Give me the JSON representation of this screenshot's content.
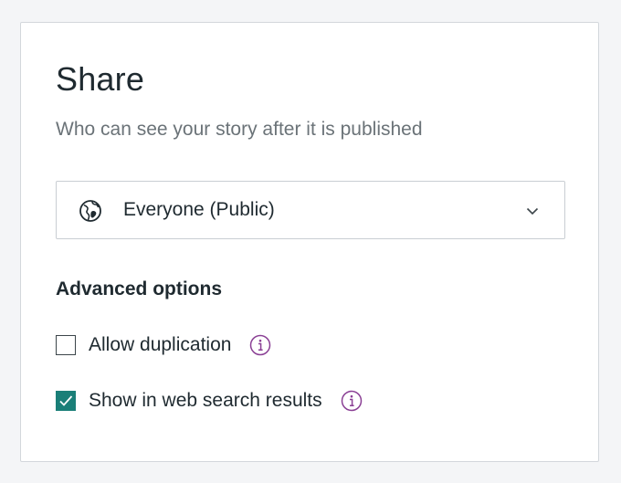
{
  "dialog": {
    "title": "Share",
    "subtitle": "Who can see your story after it is published"
  },
  "visibility": {
    "selected": "Everyone (Public)",
    "icon": "globe-icon"
  },
  "advanced": {
    "title": "Advanced options",
    "options": [
      {
        "label": "Allow duplication",
        "checked": false,
        "icon": "info-icon"
      },
      {
        "label": "Show in web search results",
        "checked": true,
        "icon": "info-icon"
      }
    ]
  },
  "colors": {
    "accent": "#1a7f78",
    "info_icon": "#8a3f94",
    "text": "#1f2a30",
    "muted": "#6b7378"
  }
}
